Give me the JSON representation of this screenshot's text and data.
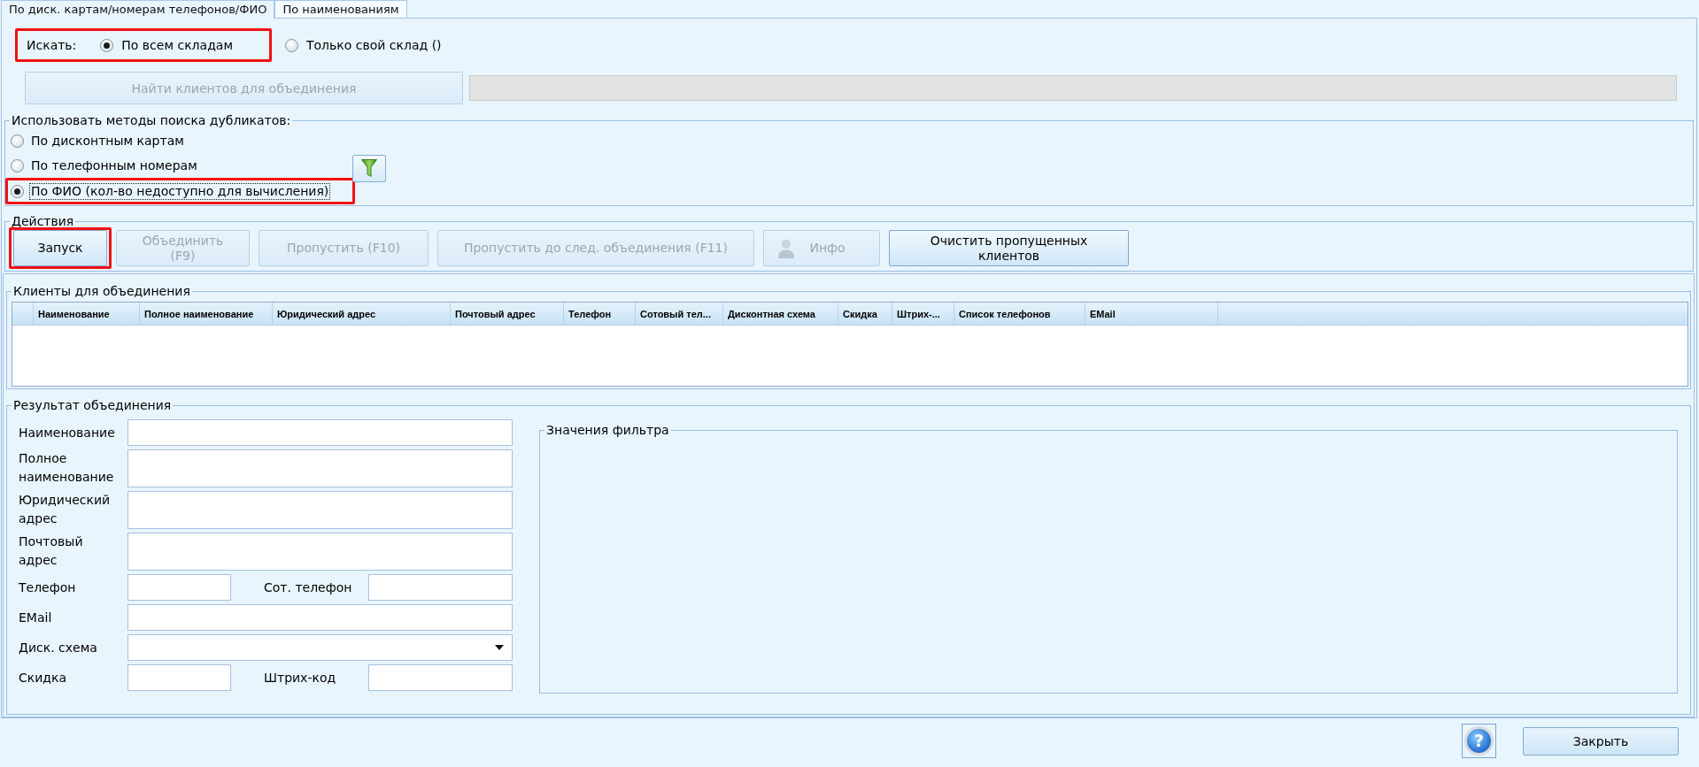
{
  "tabs": [
    {
      "label": "По диск. картам/номерам телефонов/ФИО",
      "selected": true
    },
    {
      "label": "По наименованиям",
      "selected": false
    }
  ],
  "search_scope": {
    "label": "Искать:",
    "highlighted": true,
    "options": [
      {
        "label": "По всем складам",
        "selected": true
      },
      {
        "label": "Только свой склад ()",
        "selected": false
      }
    ]
  },
  "find_button": {
    "label": "Найти клиентов для объединения",
    "disabled": true
  },
  "progress_bar": {
    "level": 0
  },
  "methods": {
    "title": "Использовать методы поиска дубликатов:",
    "options": [
      {
        "label": "По дисконтным картам",
        "selected": false,
        "focused": false,
        "highlighted": false
      },
      {
        "label": "По телефонным номерам",
        "selected": false,
        "focused": false,
        "highlighted": false
      },
      {
        "label": "По ФИО (кол-во недоступно для вычисления)",
        "selected": true,
        "focused": true,
        "highlighted": true
      }
    ]
  },
  "actions": {
    "title": "Действия",
    "buttons": [
      {
        "label": "Запуск",
        "kind": "text",
        "disabled": false,
        "highlighted": true
      },
      {
        "label": "Объединить (F9)",
        "kind": "text",
        "disabled": true,
        "highlighted": false
      },
      {
        "label": "Пропустить (F10)",
        "kind": "text",
        "disabled": true,
        "highlighted": false
      },
      {
        "label": "Пропустить до след. объединения (F11)",
        "kind": "text",
        "disabled": true,
        "highlighted": false
      },
      {
        "label": "Инфо",
        "kind": "icon",
        "disabled": true,
        "highlighted": false
      },
      {
        "label": "Очистить пропущенных клиентов",
        "kind": "text",
        "disabled": false,
        "highlighted": false
      }
    ]
  },
  "clients": {
    "title": "Клиенты для объединения",
    "columns": [
      "Наименование",
      "Полное наименование",
      "Юридический адрес",
      "Почтовый адрес",
      "Телефон",
      "Сотовый тел...",
      "Дисконтная схема",
      "Скидка",
      "Штрих-...",
      "Список телефонов",
      "EMail"
    ]
  },
  "result": {
    "title": "Результат объединения",
    "rows": [
      {
        "kind": "line",
        "label": "Наименование"
      },
      {
        "kind": "tall",
        "label": "Полное наименование"
      },
      {
        "kind": "tall",
        "label": "Юридический адрес"
      },
      {
        "kind": "tall",
        "label": "Почтовый адрес"
      },
      {
        "kind": "pair",
        "label": "Телефон",
        "label_2": "Сот. телефон"
      },
      {
        "kind": "line",
        "label": "EMail"
      },
      {
        "kind": "dropdown",
        "label": "Диск. схема"
      },
      {
        "kind": "pair",
        "label": "Скидка",
        "label_2": "Штрих-код"
      }
    ]
  },
  "filter": {
    "title": "Значения фильтра"
  },
  "footer": {
    "help_glyph": "?",
    "close_button": "Закрыть"
  }
}
